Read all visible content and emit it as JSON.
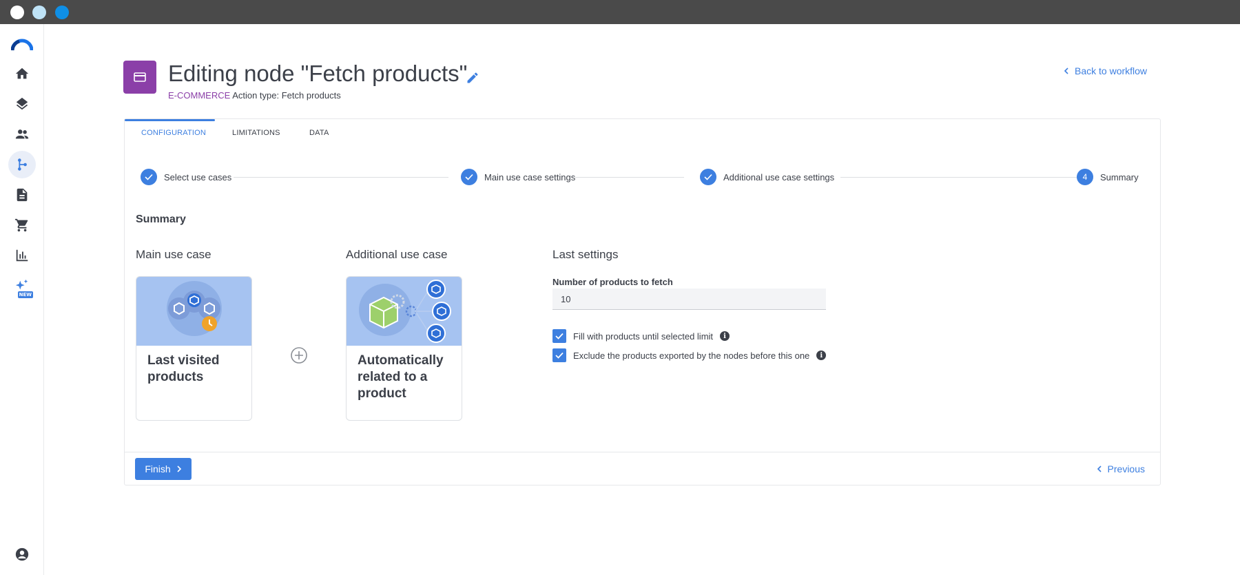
{
  "window": {
    "controls": [
      "close",
      "minimize",
      "maximize"
    ]
  },
  "sidebar": {
    "logo": "brand-arc-logo",
    "items": [
      {
        "icon": "home-icon",
        "active": false
      },
      {
        "icon": "layers-icon",
        "active": false
      },
      {
        "icon": "people-icon",
        "active": false
      },
      {
        "icon": "workflow-icon",
        "active": true
      },
      {
        "icon": "document-icon",
        "active": false
      },
      {
        "icon": "cart-icon",
        "active": false
      },
      {
        "icon": "bar-chart-icon",
        "active": false
      },
      {
        "icon": "sparkles-icon",
        "active": false,
        "badge": "NEW"
      }
    ],
    "bottom_icon": "account-icon"
  },
  "header": {
    "title": "Editing node \"Fetch products\"",
    "category": "E-COMMERCE",
    "action_type": "Action type: Fetch products",
    "back_link": "Back to workflow",
    "icon_color": "#8b3fa8"
  },
  "tabs": [
    {
      "label": "CONFIGURATION",
      "active": true
    },
    {
      "label": "LIMITATIONS",
      "active": false
    },
    {
      "label": "DATA",
      "active": false
    }
  ],
  "stepper": [
    {
      "label": "Select use cases",
      "state": "done",
      "marker": ""
    },
    {
      "label": "Main use case settings",
      "state": "done",
      "marker": ""
    },
    {
      "label": "Additional use case settings",
      "state": "done",
      "marker": ""
    },
    {
      "label": "Summary",
      "state": "current",
      "marker": "4"
    }
  ],
  "summary": {
    "title": "Summary",
    "main_use_case": {
      "heading": "Main use case",
      "label": "Last visited products"
    },
    "additional_use_case": {
      "heading": "Additional use case",
      "label": "Automatically related to a product"
    },
    "last_settings": {
      "heading": "Last settings",
      "field_label": "Number of products to fetch",
      "field_value": "10",
      "checkboxes": [
        {
          "label": "Fill with products until selected limit",
          "checked": true
        },
        {
          "label": "Exclude the products exported by the nodes before this one",
          "checked": true
        }
      ]
    }
  },
  "footer": {
    "finish_label": "Finish",
    "previous_label": "Previous"
  },
  "colors": {
    "accent": "#3d7fe0",
    "brand_purple": "#8b3fa8",
    "text": "#3c4049",
    "illustration_bg": "#a6c3f1"
  }
}
